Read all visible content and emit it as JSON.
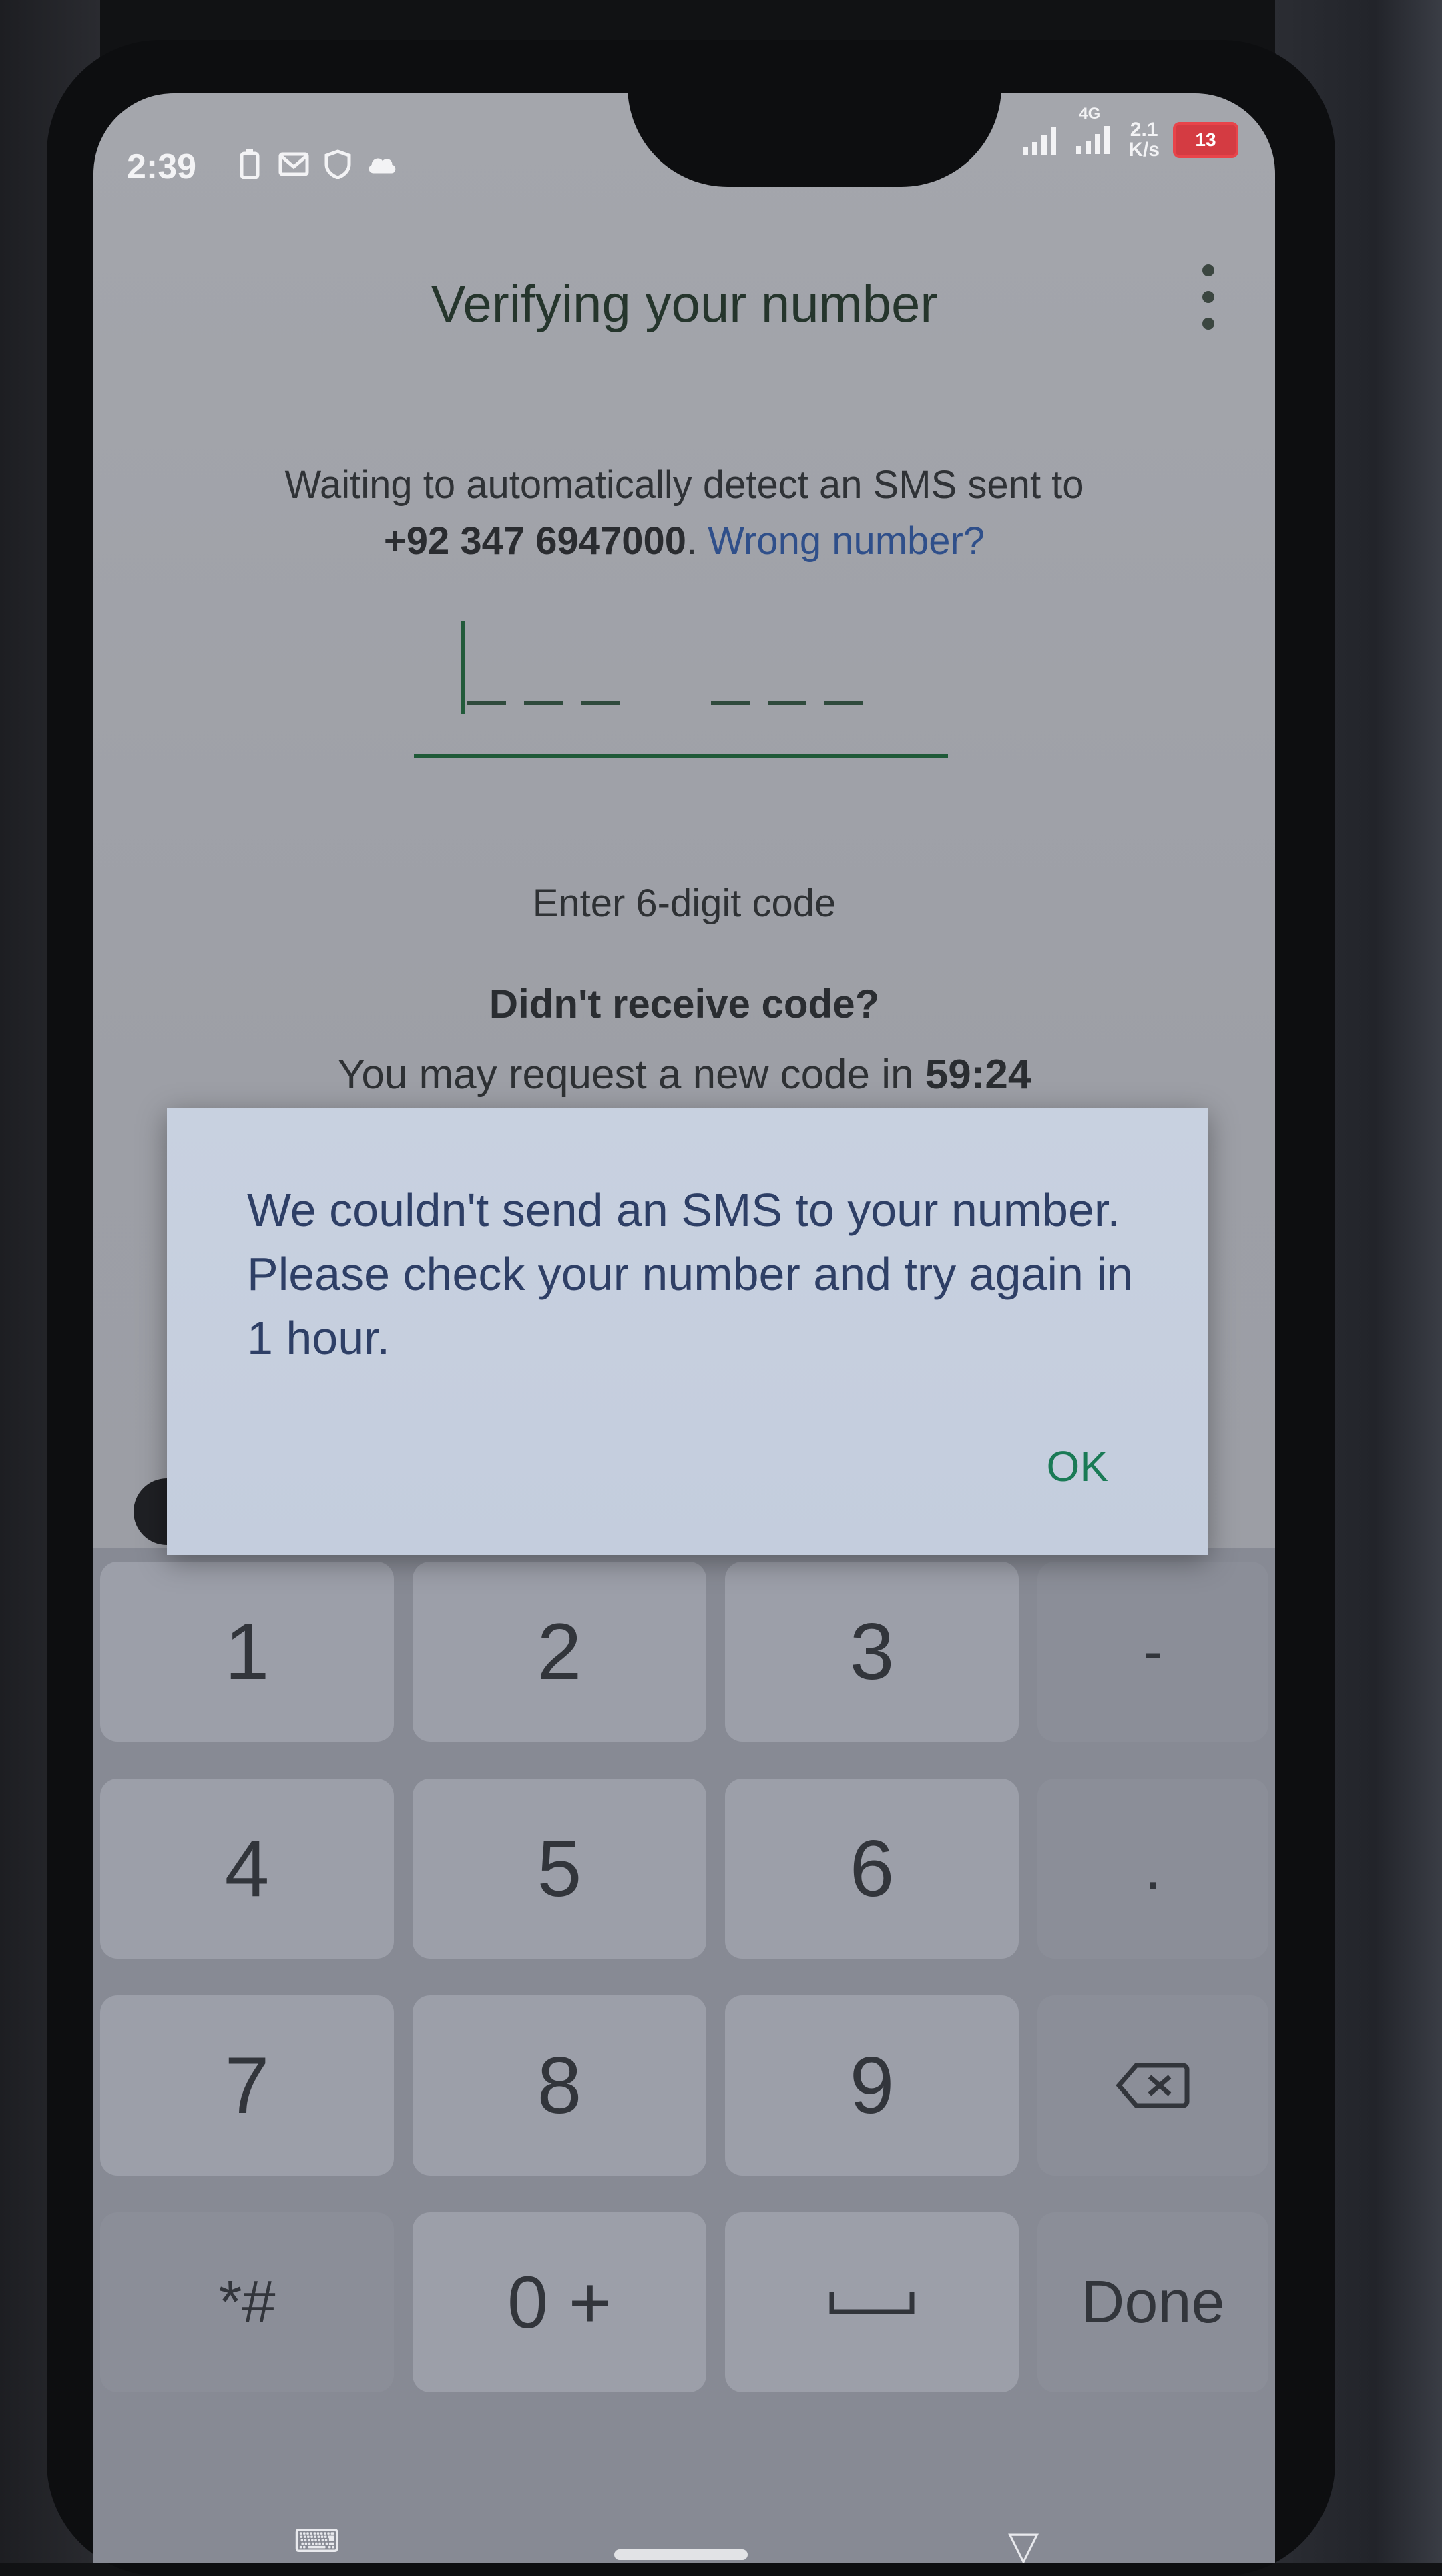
{
  "status_bar": {
    "time": "2:39",
    "network_label": "4G",
    "speed_value": "2.1",
    "speed_unit": "K/s",
    "battery": "13"
  },
  "header": {
    "title": "Verifying your number"
  },
  "description": {
    "line1": "Waiting to automatically detect an SMS sent to",
    "phone_number": "+92 347 6947000",
    "separator": ". ",
    "wrong_number_link": "Wrong number?"
  },
  "code_input": {
    "hint": "Enter 6-digit code"
  },
  "resend": {
    "heading": "Didn't receive code?",
    "prefix": "You may request a new code in ",
    "countdown": "59:24"
  },
  "dialog": {
    "message": "We couldn't send an SMS to your number. Please check your number and try again in 1 hour.",
    "ok_label": "OK"
  },
  "keyboard": {
    "keys": [
      "1",
      "2",
      "3",
      "-",
      "4",
      "5",
      "6",
      ".",
      "7",
      "8",
      "9",
      "⌫",
      "*#",
      "0 +",
      "␣",
      "Done"
    ]
  },
  "colors": {
    "accent_green": "#1a7a55",
    "link_blue": "#2f4f8a",
    "battery_red": "#d43b42"
  }
}
